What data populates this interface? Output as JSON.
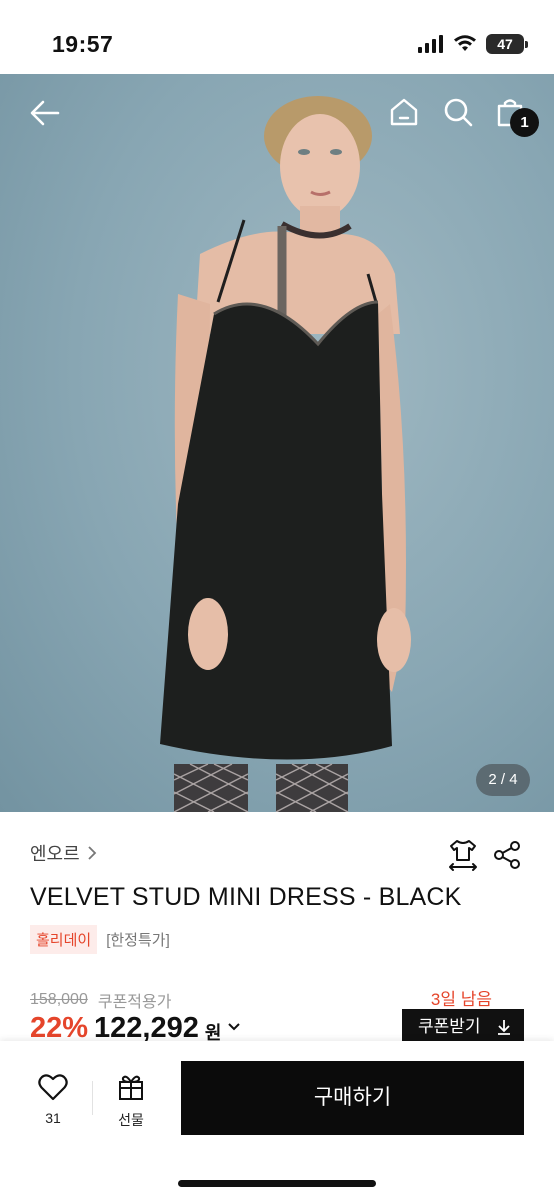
{
  "status_bar": {
    "time": "19:57",
    "battery": "47"
  },
  "hero": {
    "page_indicator": "2 / 4",
    "cart_count": "1"
  },
  "product": {
    "brand": "엔오르",
    "title": "VELVET STUD MINI DRESS - BLACK",
    "tags": [
      "홀리데이",
      "[한정특가]"
    ],
    "original_price": "158,000",
    "coupon_note": "쿠폰적용가",
    "days_left": "3일 남음",
    "discount": "22%",
    "sale_price": "122,292",
    "currency": "원",
    "coupon_button": "쿠폰받기"
  },
  "bottom_bar": {
    "like_count": "31",
    "gift_label": "선물",
    "buy_label": "구매하기"
  },
  "colors": {
    "accent": "#e5452b",
    "primary": "#0b0b0b",
    "hero_bg": "#88a6b3"
  },
  "icons": [
    "back-arrow-icon",
    "home-icon",
    "search-icon",
    "shopping-bag-icon",
    "size-fit-icon",
    "share-icon",
    "heart-icon",
    "gift-icon",
    "download-arrow-icon",
    "chevron-right-icon",
    "chevron-down-icon"
  ]
}
